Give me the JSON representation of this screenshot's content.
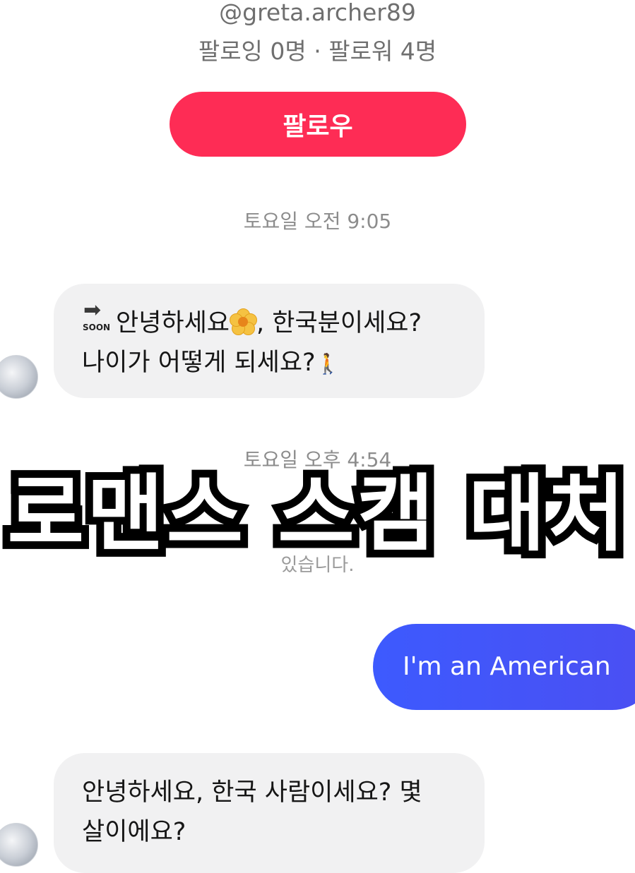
{
  "profile": {
    "handle": "@greta.archer89",
    "follow_counts": "팔로잉 0명 · 팔로워 4명",
    "follow_button_label": "팔로우"
  },
  "conversation": {
    "timestamp_1": "토요일 오전 9:05",
    "message_1": {
      "soon_label": "SOON",
      "line_1_a": "안녕하세요",
      "line_1_b": ", 한국분이세요?",
      "line_2": "나이가 어떻게 되세요?"
    },
    "timestamp_2": "토요일 오후 4:54",
    "hidden_notice_fragment": "있습니다.",
    "message_2": "I'm an American",
    "message_3": {
      "line_1": "안녕하세요, 한국 사람이세요? 몇",
      "line_2": "살이에요?"
    }
  },
  "overlay": {
    "title": "로맨스 스캠 대처"
  },
  "colors": {
    "follow_button": "#fe2c55",
    "outgoing_bubble": "#3d5afe",
    "incoming_bubble": "#f1f1f2"
  },
  "icons": [
    "soon-arrow-icon",
    "flower-icon",
    "person-walking-icon",
    "avatar"
  ]
}
